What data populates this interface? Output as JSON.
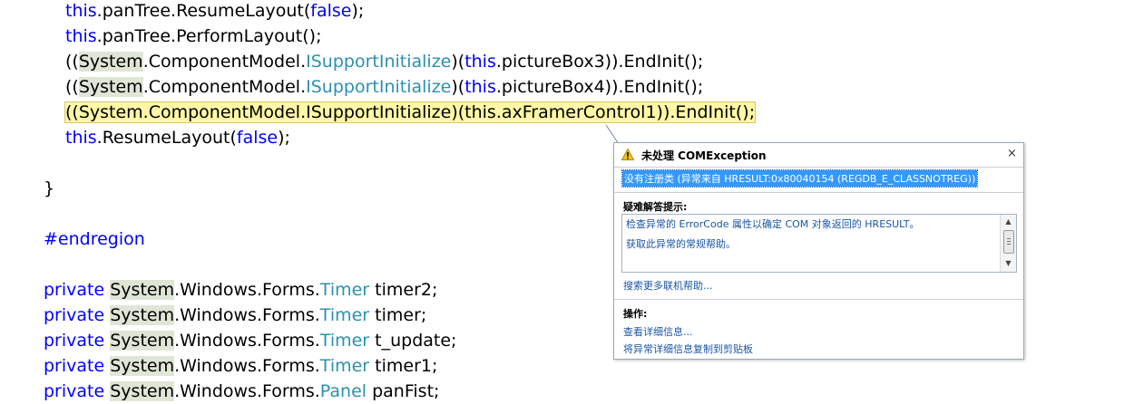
{
  "code": {
    "line1": {
      "kw": "this",
      "rest_a": ".panTree.ResumeLayout(",
      "arg": "false",
      "rest_b": ");"
    },
    "line2": {
      "kw": "this",
      "rest": ".panTree.PerformLayout();"
    },
    "line3": {
      "open": "((",
      "sys": "System",
      "mid": ".ComponentModel.",
      "iface": "ISupportInitialize",
      "p": ")(",
      "kw": "this",
      "rest": ".pictureBox3)).EndInit();"
    },
    "line4": {
      "open": "((",
      "sys": "System",
      "mid": ".ComponentModel.",
      "iface": "ISupportInitialize",
      "p": ")(",
      "kw": "this",
      "rest": ".pictureBox4)).EndInit();"
    },
    "line5": {
      "text": "((System.ComponentModel.ISupportInitialize)(this.axFramerControl1)).EndInit();"
    },
    "line6": {
      "kw": "this",
      "rest_a": ".ResumeLayout(",
      "arg": "false",
      "rest_b": ");"
    },
    "line7": {
      "text": "}"
    },
    "line8": {
      "text": "#endregion"
    },
    "fields": [
      {
        "kw": "private",
        "sys": "System",
        "ns": ".Windows.Forms.",
        "type": "Timer",
        "name": " timer2;"
      },
      {
        "kw": "private",
        "sys": "System",
        "ns": ".Windows.Forms.",
        "type": "Timer",
        "name": " timer;"
      },
      {
        "kw": "private",
        "sys": "System",
        "ns": ".Windows.Forms.",
        "type": "Timer",
        "name": " t_update;"
      },
      {
        "kw": "private",
        "sys": "System",
        "ns": ".Windows.Forms.",
        "type": "Timer",
        "name": " timer1;"
      },
      {
        "kw": "private",
        "sys": "System",
        "ns": ".Windows.Forms.",
        "type": "Panel",
        "name": " panFist;"
      }
    ]
  },
  "exception": {
    "title": "未处理 COMException",
    "close": "×",
    "message": "没有注册类 (异常来自 HRESULT:0x80040154 (REGDB_E_CLASSNOTREG))",
    "tips_heading": "疑难解答提示:",
    "tips": [
      "检查异常的 ErrorCode 属性以确定 COM 对象返回的 HRESULT。",
      "获取此异常的常规帮助。"
    ],
    "search_link": "搜索更多联机帮助...",
    "actions_heading": "操作:",
    "actions": [
      "查看详细信息...",
      "将异常详细信息复制到剪贴板"
    ]
  },
  "colors": {
    "keyword": "#0000ff",
    "type": "#2b91af",
    "highlight": "#fdf7a6",
    "selection": "#3399ff"
  },
  "icons": {
    "warning": "warning-icon",
    "close": "close-icon"
  }
}
